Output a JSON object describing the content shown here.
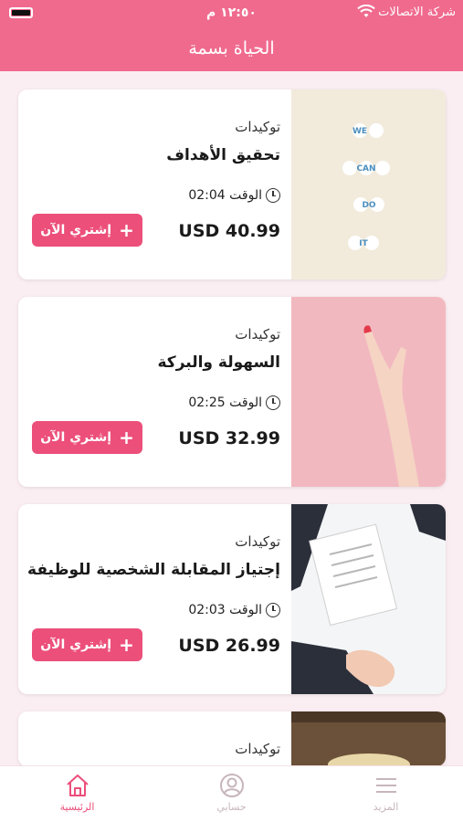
{
  "status": {
    "carrier": "شركة الاتصالات",
    "time": "١٢:٥٠ م"
  },
  "header": {
    "title": "الحياة بسمة"
  },
  "products": [
    {
      "category": "توكيدات",
      "title": "تحقيق الأهداف",
      "duration_label": "الوقت 02:04",
      "price": "USD 40.99",
      "buy_label": "إشتري الآن",
      "image_letters": [
        "WE",
        "CAN",
        "DO",
        "IT"
      ]
    },
    {
      "category": "توكيدات",
      "title": "السهولة والبركة",
      "duration_label": "الوقت 02:25",
      "price": "USD 32.99",
      "buy_label": "إشتري الآن"
    },
    {
      "category": "توكيدات",
      "title": "إجتياز المقابلة الشخصية للوظيفة",
      "duration_label": "الوقت 02:03",
      "price": "USD 26.99",
      "buy_label": "إشتري الآن"
    },
    {
      "category": "توكيدات"
    }
  ],
  "tabs": [
    {
      "label": "الرئيسية",
      "icon": "home-icon",
      "active": true
    },
    {
      "label": "حسابي",
      "icon": "user-icon",
      "active": false
    },
    {
      "label": "المزيد",
      "icon": "menu-icon",
      "active": false
    }
  ],
  "colors": {
    "brand": "#f06a8e",
    "button": "#ec4f7a",
    "background": "#fbeef2"
  }
}
